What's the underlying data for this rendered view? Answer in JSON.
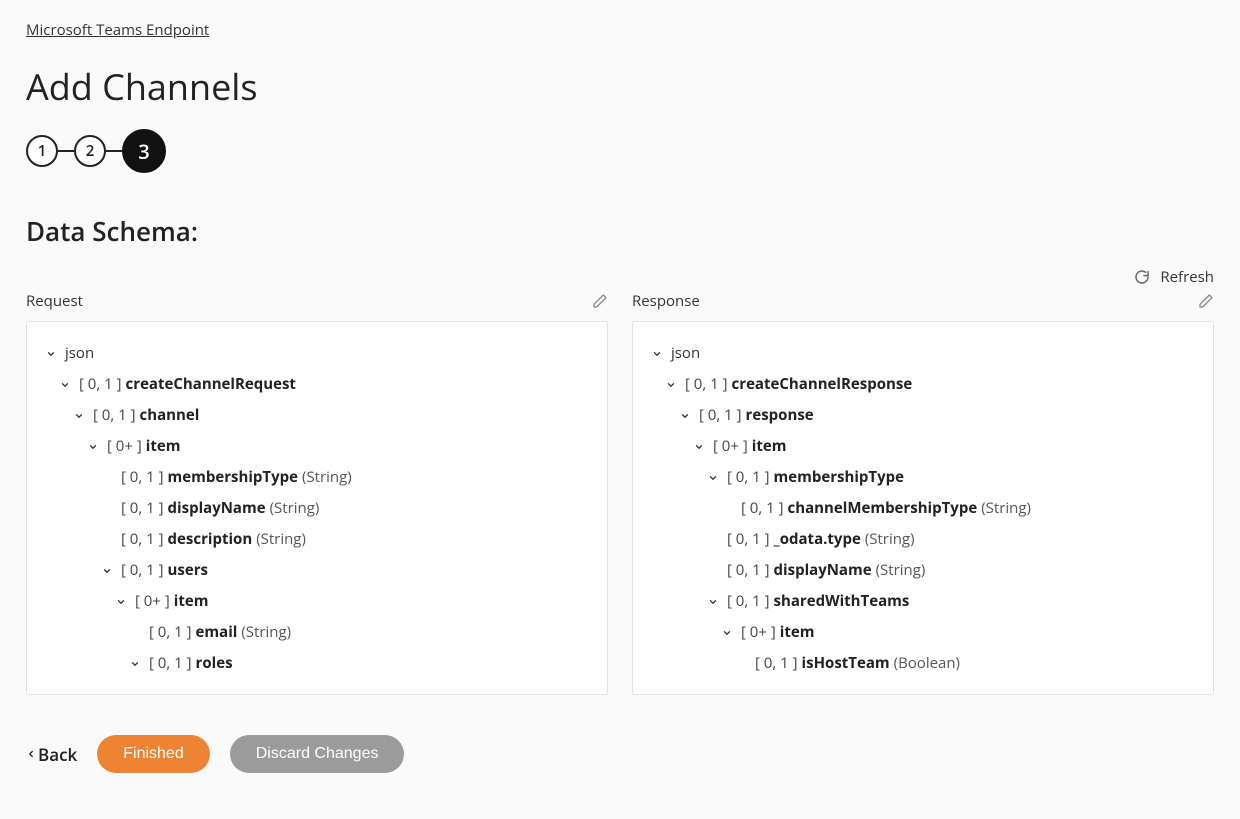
{
  "breadcrumb": "Microsoft Teams Endpoint",
  "page_title": "Add Channels",
  "steps": [
    "1",
    "2",
    "3"
  ],
  "active_step_index": 2,
  "section_title": "Data Schema:",
  "refresh_label": "Refresh",
  "request_label": "Request",
  "response_label": "Response",
  "footer": {
    "back": "Back",
    "finished": "Finished",
    "discard": "Discard Changes"
  },
  "request_tree": [
    {
      "level": 0,
      "expandable": true,
      "cardinality": "",
      "name": "json",
      "type": "",
      "bold": false
    },
    {
      "level": 1,
      "expandable": true,
      "cardinality": "[ 0, 1 ]",
      "name": "createChannelRequest",
      "type": "",
      "bold": true
    },
    {
      "level": 2,
      "expandable": true,
      "cardinality": "[ 0, 1 ]",
      "name": "channel",
      "type": "",
      "bold": true
    },
    {
      "level": 3,
      "expandable": true,
      "cardinality": "[ 0+ ]",
      "name": "item",
      "type": "",
      "bold": true
    },
    {
      "level": 4,
      "expandable": false,
      "cardinality": "[ 0, 1 ]",
      "name": "membershipType",
      "type": "(String)",
      "bold": true
    },
    {
      "level": 4,
      "expandable": false,
      "cardinality": "[ 0, 1 ]",
      "name": "displayName",
      "type": "(String)",
      "bold": true
    },
    {
      "level": 4,
      "expandable": false,
      "cardinality": "[ 0, 1 ]",
      "name": "description",
      "type": "(String)",
      "bold": true
    },
    {
      "level": 4,
      "expandable": true,
      "cardinality": "[ 0, 1 ]",
      "name": "users",
      "type": "",
      "bold": true
    },
    {
      "level": 5,
      "expandable": true,
      "cardinality": "[ 0+ ]",
      "name": "item",
      "type": "",
      "bold": true
    },
    {
      "level": 6,
      "expandable": false,
      "cardinality": "[ 0, 1 ]",
      "name": "email",
      "type": "(String)",
      "bold": true
    },
    {
      "level": 6,
      "expandable": true,
      "cardinality": "[ 0, 1 ]",
      "name": "roles",
      "type": "",
      "bold": true
    }
  ],
  "response_tree": [
    {
      "level": 0,
      "expandable": true,
      "cardinality": "",
      "name": "json",
      "type": "",
      "bold": false
    },
    {
      "level": 1,
      "expandable": true,
      "cardinality": "[ 0, 1 ]",
      "name": "createChannelResponse",
      "type": "",
      "bold": true
    },
    {
      "level": 2,
      "expandable": true,
      "cardinality": "[ 0, 1 ]",
      "name": "response",
      "type": "",
      "bold": true
    },
    {
      "level": 3,
      "expandable": true,
      "cardinality": "[ 0+ ]",
      "name": "item",
      "type": "",
      "bold": true
    },
    {
      "level": 4,
      "expandable": true,
      "cardinality": "[ 0, 1 ]",
      "name": "membershipType",
      "type": "",
      "bold": true
    },
    {
      "level": 5,
      "expandable": false,
      "cardinality": "[ 0, 1 ]",
      "name": "channelMembershipType",
      "type": "(String)",
      "bold": true
    },
    {
      "level": 4,
      "expandable": false,
      "cardinality": "[ 0, 1 ]",
      "name": "_odata.type",
      "type": "(String)",
      "bold": true
    },
    {
      "level": 4,
      "expandable": false,
      "cardinality": "[ 0, 1 ]",
      "name": "displayName",
      "type": "(String)",
      "bold": true
    },
    {
      "level": 4,
      "expandable": true,
      "cardinality": "[ 0, 1 ]",
      "name": "sharedWithTeams",
      "type": "",
      "bold": true
    },
    {
      "level": 5,
      "expandable": true,
      "cardinality": "[ 0+ ]",
      "name": "item",
      "type": "",
      "bold": true
    },
    {
      "level": 6,
      "expandable": false,
      "cardinality": "[ 0, 1 ]",
      "name": "isHostTeam",
      "type": "(Boolean)",
      "bold": true
    }
  ]
}
